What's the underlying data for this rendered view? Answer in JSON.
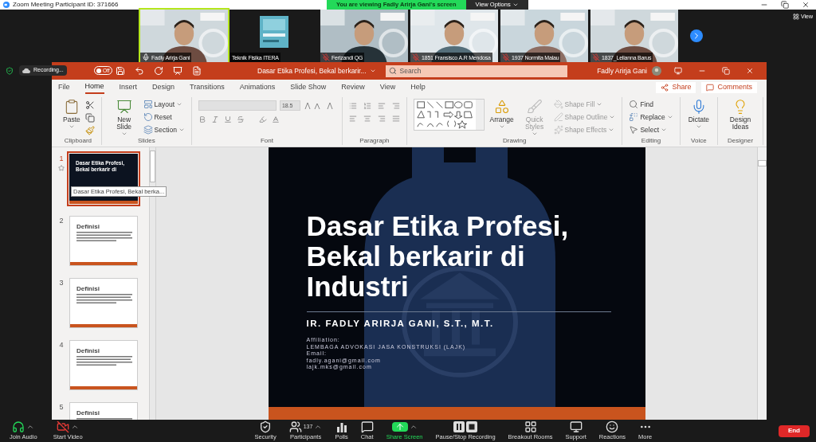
{
  "zoom": {
    "title": "Zoom Meeting Participant ID: 371666",
    "banner": "You are viewing Fadly Arirja Gani's screen",
    "view_options": "View Options",
    "view": "View"
  },
  "participants": [
    {
      "name": "Fadly Arirja Gani",
      "kind": "video",
      "muted": false,
      "speaking": true
    },
    {
      "name": "Teknik Fisika ITERA",
      "kind": "logo",
      "speaking": false
    },
    {
      "name": "Ferizandi QG",
      "kind": "video",
      "muted": true,
      "speaking": false
    },
    {
      "name": "1851 Fransisco A.R Mendosa",
      "kind": "video",
      "muted": true,
      "speaking": false
    },
    {
      "name": "1937 Normita Malau",
      "kind": "video",
      "muted": true,
      "speaking": false
    },
    {
      "name": "1837_Lelianna Barus",
      "kind": "video",
      "muted": true,
      "speaking": false
    }
  ],
  "recording": {
    "label": "Recording...",
    "autosave": {
      "label": "Off",
      "on": false
    }
  },
  "powerpoint": {
    "doc_title": "Dasar Etika Profesi, Bekal berkarir...",
    "search": {
      "placeholder": "Search"
    },
    "user": "Fadly Arirja Gani",
    "tabs": [
      {
        "label": "File",
        "selected": false
      },
      {
        "label": "Home",
        "selected": true
      },
      {
        "label": "Insert",
        "selected": false
      },
      {
        "label": "Design",
        "selected": false
      },
      {
        "label": "Transitions",
        "selected": false
      },
      {
        "label": "Animations",
        "selected": false
      },
      {
        "label": "Slide Show",
        "selected": false
      },
      {
        "label": "Review",
        "selected": false
      },
      {
        "label": "View",
        "selected": false
      },
      {
        "label": "Help",
        "selected": false
      }
    ],
    "share": "Share",
    "comments": "Comments",
    "ribbon": [
      {
        "label": "Clipboard",
        "kind": "clipboard",
        "buttons": [
          {
            "label": "Paste",
            "dropdown": true,
            "disabled": false
          }
        ]
      },
      {
        "label": "Slides",
        "kind": "slides",
        "buttons": [
          {
            "label": "New Slide",
            "dropdown": true,
            "disabled": false
          },
          {
            "label": "Layout",
            "dropdown": true,
            "disabled": false
          },
          {
            "label": "Reset",
            "dropdown": false,
            "disabled": false
          },
          {
            "label": "Section",
            "dropdown": true,
            "disabled": false
          }
        ]
      },
      {
        "label": "Font",
        "kind": "font",
        "font_size": "18.5"
      },
      {
        "label": "Paragraph",
        "kind": "paragraph"
      },
      {
        "label": "Drawing",
        "kind": "drawing",
        "buttons": [
          {
            "label": "Arrange",
            "dropdown": true,
            "disabled": false
          },
          {
            "label": "Quick Styles",
            "dropdown": true,
            "disabled": true
          },
          {
            "label": "Shape Fill",
            "dropdown": true,
            "disabled": true
          },
          {
            "label": "Shape Outline",
            "dropdown": true,
            "disabled": true
          },
          {
            "label": "Shape Effects",
            "dropdown": true,
            "disabled": true
          }
        ]
      },
      {
        "label": "Editing",
        "kind": "editing",
        "buttons": [
          {
            "label": "Find",
            "dropdown": false,
            "disabled": false
          },
          {
            "label": "Replace",
            "dropdown": true,
            "disabled": false
          },
          {
            "label": "Select",
            "dropdown": true,
            "disabled": false
          }
        ]
      },
      {
        "label": "Voice",
        "kind": "voice",
        "buttons": [
          {
            "label": "Dictate",
            "dropdown": true,
            "disabled": false
          }
        ]
      },
      {
        "label": "Designer",
        "kind": "designer",
        "buttons": [
          {
            "label": "Design Ideas",
            "dropdown": false,
            "disabled": false
          }
        ]
      }
    ],
    "slides": [
      {
        "number": "1",
        "kind": "title",
        "title": "Dasar Etika Profesi, Bekal berkarir di",
        "selected": true
      },
      {
        "number": "2",
        "kind": "content",
        "title": "Definisi",
        "selected": false
      },
      {
        "number": "3",
        "kind": "content",
        "title": "Definisi",
        "selected": false
      },
      {
        "number": "4",
        "kind": "content",
        "title": "Definisi",
        "selected": false
      },
      {
        "number": "5",
        "kind": "content",
        "title": "Definisi",
        "selected": false
      }
    ],
    "tooltip": "Dasar Etika Profesi, Bekal berka...",
    "current_slide": {
      "title_lines": [
        "Dasar Etika Profesi,",
        "Bekal berkarir di",
        "Industri"
      ],
      "author": "IR. FADLY ARIRJA GANI, S.T., M.T.",
      "details": [
        "Affiliation:",
        "LEMBAGA ADVOKASI JASA KONSTRUKSI (LAJK)",
        "Email:",
        "fadly.agani@gmail.com",
        "lajk.mks@gmail.com"
      ]
    }
  },
  "toolbar": [
    {
      "label": "Join Audio",
      "dropdown": true,
      "active": false
    },
    {
      "label": "Start Video",
      "dropdown": true,
      "active": false
    },
    {
      "label": "Security",
      "dropdown": false,
      "active": false
    },
    {
      "label": "Participants",
      "count": "137",
      "dropdown": true,
      "active": false
    },
    {
      "label": "Polls",
      "dropdown": false,
      "active": false
    },
    {
      "label": "Chat",
      "dropdown": false,
      "active": false
    },
    {
      "label": "Share Screen",
      "dropdown": true,
      "active": true
    },
    {
      "label": "Pause/Stop Recording",
      "dropdown": false,
      "active": false
    },
    {
      "label": "Breakout Rooms",
      "dropdown": false,
      "active": false
    },
    {
      "label": "Support",
      "dropdown": false,
      "active": false
    },
    {
      "label": "Reactions",
      "dropdown": false,
      "active": false
    },
    {
      "label": "More",
      "dropdown": false,
      "active": false
    }
  ],
  "end": "End"
}
